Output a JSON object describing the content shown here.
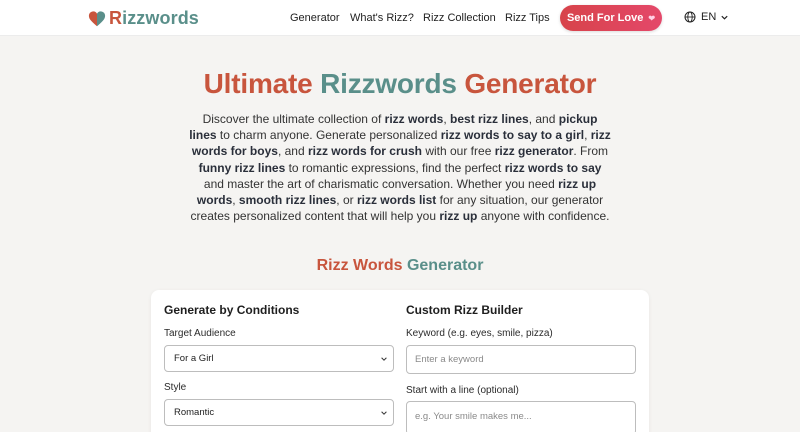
{
  "brand": {
    "r": "R",
    "rest": "izzwords"
  },
  "nav": {
    "generator": "Generator",
    "whats": "What's Rizz?",
    "collection": "Rizz Collection",
    "tips": "Rizz Tips"
  },
  "cta": {
    "love": "Send For Love"
  },
  "lang": {
    "current": "EN"
  },
  "hero": {
    "title_a": "Ultimate ",
    "title_b": "Rizzwords",
    "title_c": " Generator",
    "intro": [
      [
        "t",
        "Discover the ultimate collection of "
      ],
      [
        "b",
        "rizz words"
      ],
      [
        "t",
        ", "
      ],
      [
        "b",
        "best rizz lines"
      ],
      [
        "t",
        ", and "
      ],
      [
        "b",
        "pickup lines"
      ],
      [
        "t",
        " to charm anyone. Generate personalized "
      ],
      [
        "b",
        "rizz words to say to a girl"
      ],
      [
        "t",
        ", "
      ],
      [
        "b",
        "rizz words for boys"
      ],
      [
        "t",
        ", and "
      ],
      [
        "b",
        "rizz words for crush"
      ],
      [
        "t",
        " with our free "
      ],
      [
        "b",
        "rizz generator"
      ],
      [
        "t",
        ". From "
      ],
      [
        "b",
        "funny rizz lines"
      ],
      [
        "t",
        " to romantic expressions, find the perfect "
      ],
      [
        "b",
        "rizz words to say"
      ],
      [
        "t",
        " and master the art of charismatic conversation. Whether you need "
      ],
      [
        "b",
        "rizz up words"
      ],
      [
        "t",
        ", "
      ],
      [
        "b",
        "smooth rizz lines"
      ],
      [
        "t",
        ", or "
      ],
      [
        "b",
        "rizz words list"
      ],
      [
        "t",
        " for any situation, our generator creates personalized content that will help you "
      ],
      [
        "b",
        "rizz up"
      ],
      [
        "t",
        " anyone with confidence."
      ]
    ]
  },
  "generator": {
    "title_a": "Rizz Words",
    "title_b": " Generator",
    "conditions": {
      "title": "Generate by Conditions",
      "audience_label": "Target Audience",
      "audience_value": "For a Girl",
      "style_label": "Style",
      "style_value": "Romantic"
    },
    "custom": {
      "title": "Custom Rizz Builder",
      "keyword_label": "Keyword (e.g. eyes, smile, pizza)",
      "keyword_placeholder": "Enter a keyword",
      "start_label": "Start with a line (optional)",
      "start_placeholder": "e.g. Your smile makes me..."
    }
  },
  "colors": {
    "brand_red": "#c8553d",
    "brand_teal": "#5a8f8a",
    "cta": "#d7434a"
  },
  "icons": {
    "logo": "heart-icon",
    "language": "globe-icon",
    "dropdown": "chevron-down-icon"
  }
}
